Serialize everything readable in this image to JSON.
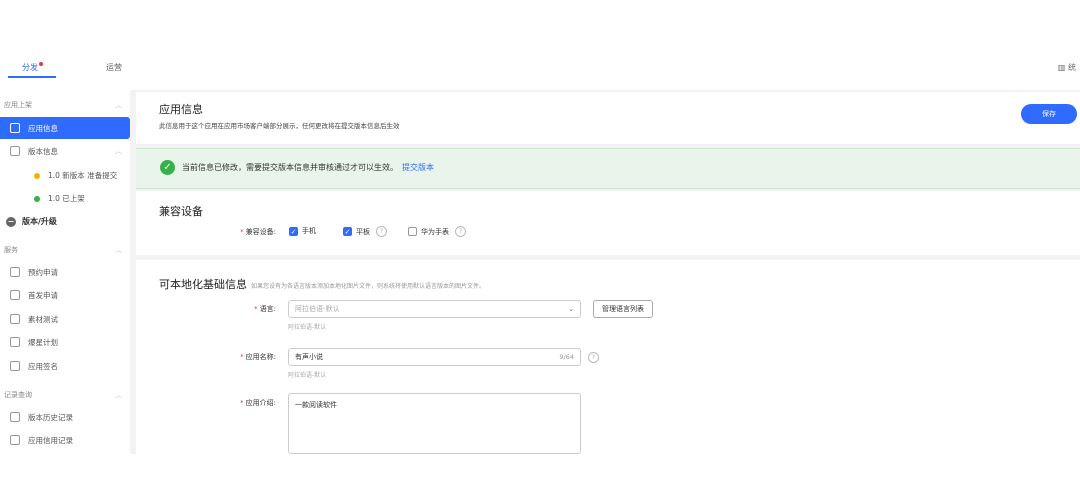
{
  "topbar": {
    "tabs": [
      {
        "label": "分发"
      },
      {
        "label": "运营"
      }
    ],
    "right_label": "统"
  },
  "sidebar": {
    "group_app_listing": "应用上架",
    "item_app_info": "应用信息",
    "item_version_info": "版本信息",
    "sub_versions": [
      {
        "label": "1.0 新版本 准备提交",
        "color": "#f0b400"
      },
      {
        "label": "1.0 已上架",
        "color": "#36b04a"
      }
    ],
    "item_upgrade": "版本/升级",
    "group_service": "服务",
    "service_items": [
      "预约申请",
      "首发申请",
      "素材测试",
      "爆星计划",
      "应用签名"
    ],
    "group_records": "记录查询",
    "record_items": [
      "版本历史记录",
      "应用信用记录"
    ]
  },
  "header": {
    "title": "应用信息",
    "subtitle": "此信息用于这个应用在应用市场客户端部分展示，任何更改将在提交版本信息后生效",
    "save_label": "保存"
  },
  "notice": {
    "message": "当前信息已修改，需要提交版本信息并审核通过才可以生效。",
    "link": "提交版本"
  },
  "compat": {
    "title": "兼容设备",
    "field_label": "兼容设备:",
    "options": [
      {
        "label": "手机",
        "checked": true
      },
      {
        "label": "平板",
        "checked": true
      },
      {
        "label": "华为手表",
        "checked": false
      }
    ]
  },
  "localization": {
    "title": "可本地化基础信息",
    "desc": "如果您设有为各语言版本添加本地化图片文件，则系统将使用默认语言版本的图片文件。",
    "language_label": "语言:",
    "language_placeholder": "阿拉伯语-默认",
    "language_hint": "阿拉伯语-默认",
    "manage_button": "管理语言列表",
    "app_name_label": "应用名称:",
    "app_name_value": "有声小说",
    "app_name_counter": "9/64",
    "app_name_hint": "阿拉伯语-默认",
    "app_intro_label": "应用介绍:",
    "app_intro_value": "一款阅读软件"
  }
}
